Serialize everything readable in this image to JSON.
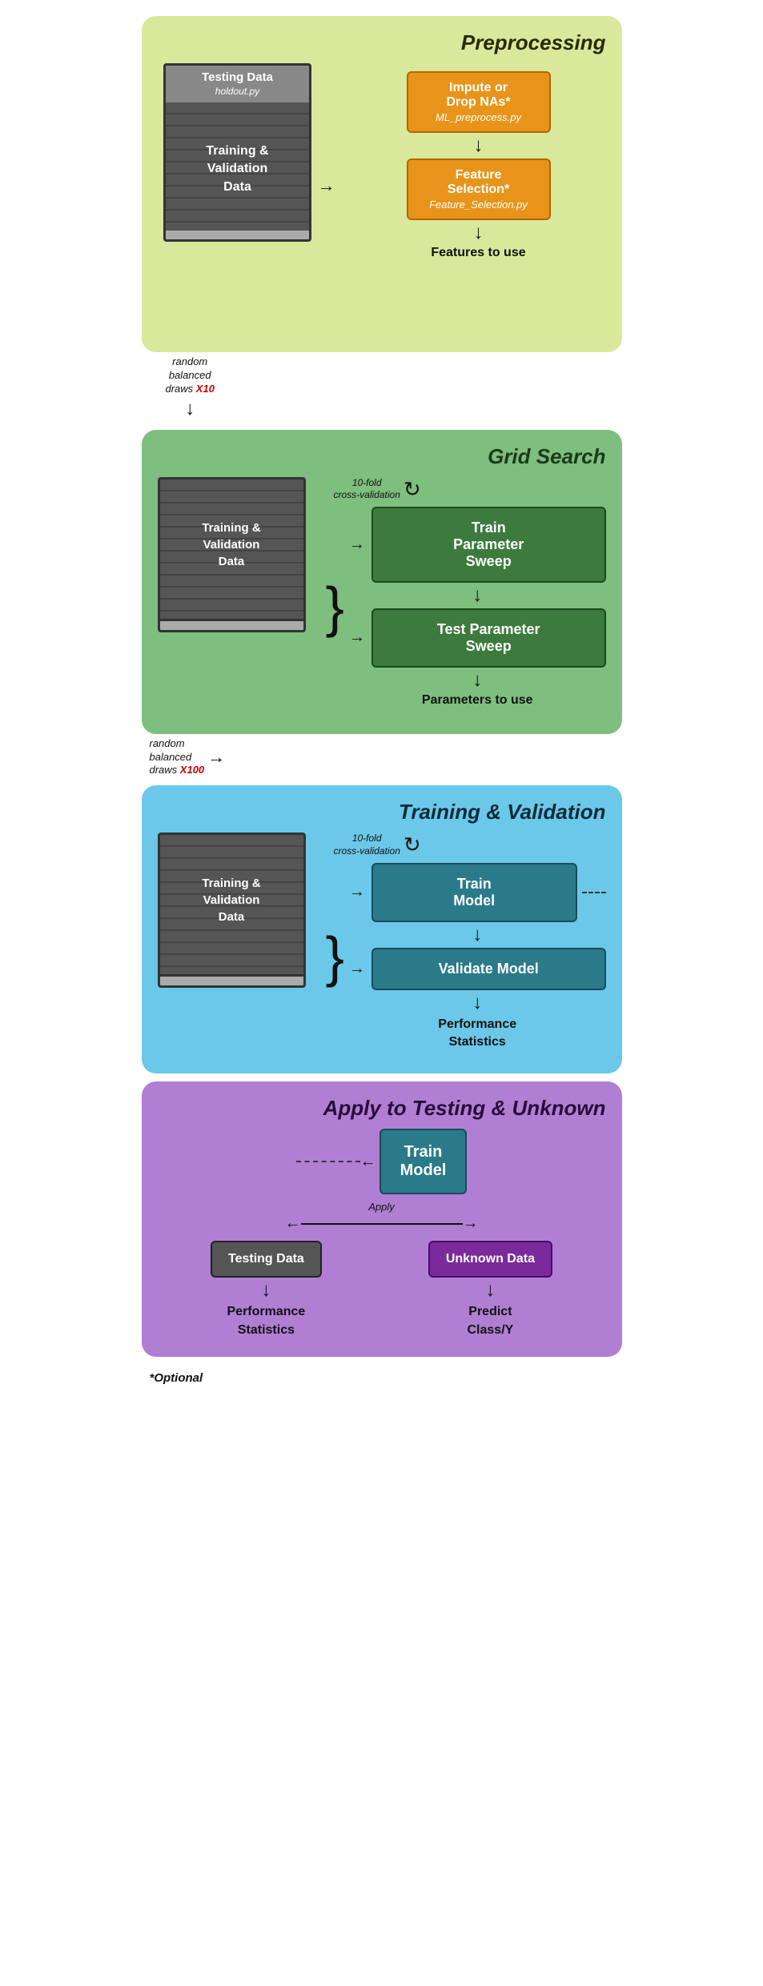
{
  "sections": {
    "preprocessing": {
      "title": "Preprocessing",
      "testing_data_label": "Testing Data",
      "holdout_label": "holdout.py",
      "training_validation_label": "Training &\nValidation\nData",
      "impute_title": "Impute or\nDrop NAs*",
      "impute_subtitle": "ML_preprocess.py",
      "feature_title": "Feature\nSelection*",
      "feature_subtitle": "Feature_Selection.py",
      "features_to_use": "Features to use"
    },
    "gridsearch": {
      "title": "Grid Search",
      "draws_label": "random\nbalanced\ndraws X10",
      "x10_label": "X10",
      "cv_label": "10-fold\ncross-validation",
      "training_validation_label": "Training &\nValidation\nData",
      "train_sweep": "Train\nParameter\nSweep",
      "test_sweep": "Test Parameter\nSweep",
      "params_label": "Parameters to use"
    },
    "training": {
      "title": "Training & Validation",
      "draws_label": "random\nbalanced\ndraws X100",
      "x100_label": "X100",
      "cv_label": "10-fold\ncross-validation",
      "training_validation_label": "Training &\nValidation\nData",
      "train_model": "Train\nModel",
      "validate_model": "Validate Model",
      "performance_stats": "Performance\nStatistics"
    },
    "apply": {
      "title": "Apply to Testing & Unknown",
      "train_model": "Train\nModel",
      "apply_label": "Apply",
      "testing_data": "Testing Data",
      "unknown_data": "Unknown Data",
      "performance_stats": "Performance\nStatistics",
      "predict_label": "Predict\nClass/Y"
    }
  },
  "optional_note": "*Optional"
}
